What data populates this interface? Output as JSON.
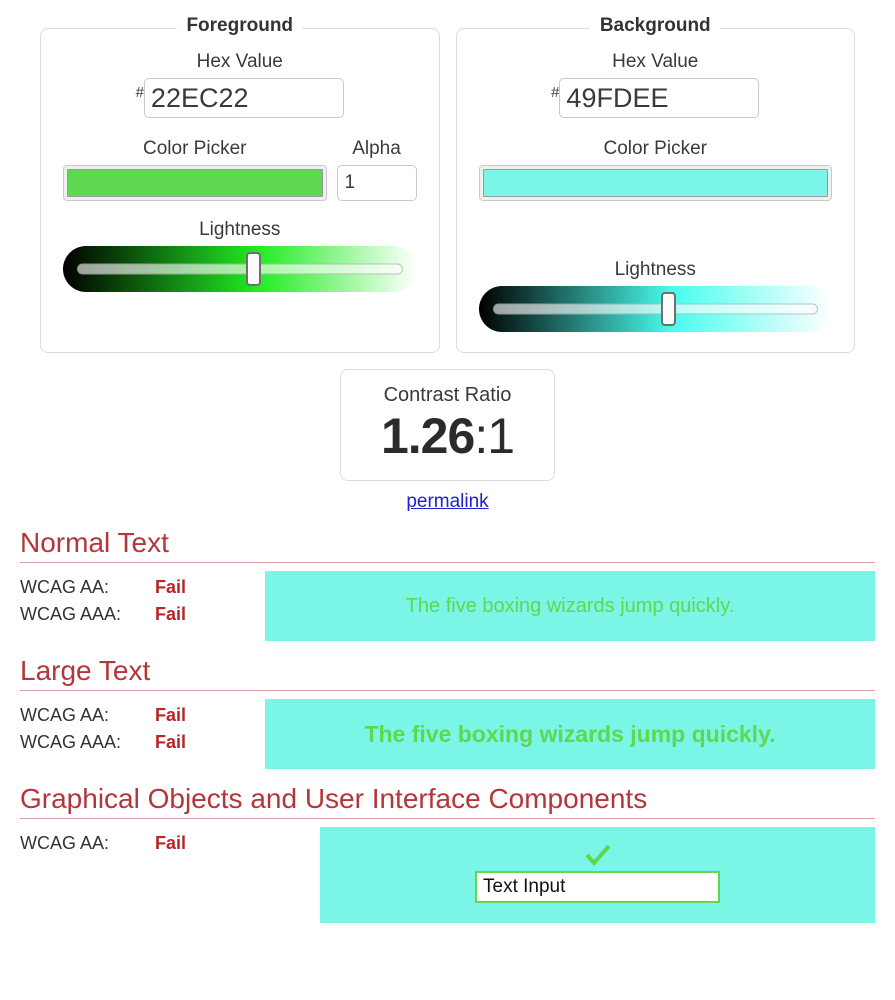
{
  "foreground": {
    "legend": "Foreground",
    "hex_label": "Hex Value",
    "hash": "#",
    "hex_value": "22EC22",
    "picker_label": "Color Picker",
    "swatch_color": "#5ED84E",
    "alpha_label": "Alpha",
    "alpha_value": "1",
    "lightness_label": "Lightness",
    "lightness_percent": 54,
    "gradient_mid": "#22EC22"
  },
  "background": {
    "legend": "Background",
    "hex_label": "Hex Value",
    "hash": "#",
    "hex_value": "49FDEE",
    "picker_label": "Color Picker",
    "swatch_color": "#7BF5E6",
    "lightness_label": "Lightness",
    "lightness_percent": 54,
    "gradient_mid": "#49FDEE"
  },
  "contrast": {
    "label": "Contrast Ratio",
    "value": "1.26",
    "suffix": ":1",
    "permalink": "permalink"
  },
  "sections": [
    {
      "title": "Normal Text",
      "results": [
        {
          "key": "WCAG AA:",
          "value": "Fail"
        },
        {
          "key": "WCAG AAA:",
          "value": "Fail"
        }
      ],
      "sample_text": "The five boxing wizards jump quickly.",
      "sample_fg": "#5ED84E",
      "sample_bg": "#7BF5E6"
    },
    {
      "title": "Large Text",
      "results": [
        {
          "key": "WCAG AA:",
          "value": "Fail"
        },
        {
          "key": "WCAG AAA:",
          "value": "Fail"
        }
      ],
      "sample_text": "The five boxing wizards jump quickly.",
      "sample_fg": "#5ED84E",
      "sample_bg": "#7BF5E6"
    },
    {
      "title": "Graphical Objects and User Interface Components",
      "results": [
        {
          "key": "WCAG AA:",
          "value": "Fail"
        }
      ],
      "check_icon": "checkmark-icon",
      "input_value": "Text Input",
      "sample_fg": "#5ED84E",
      "sample_bg": "#7BF5E6"
    }
  ],
  "colors": {
    "heading": "#b5363a",
    "fail": "#b5252b",
    "link": "#2121cc"
  }
}
